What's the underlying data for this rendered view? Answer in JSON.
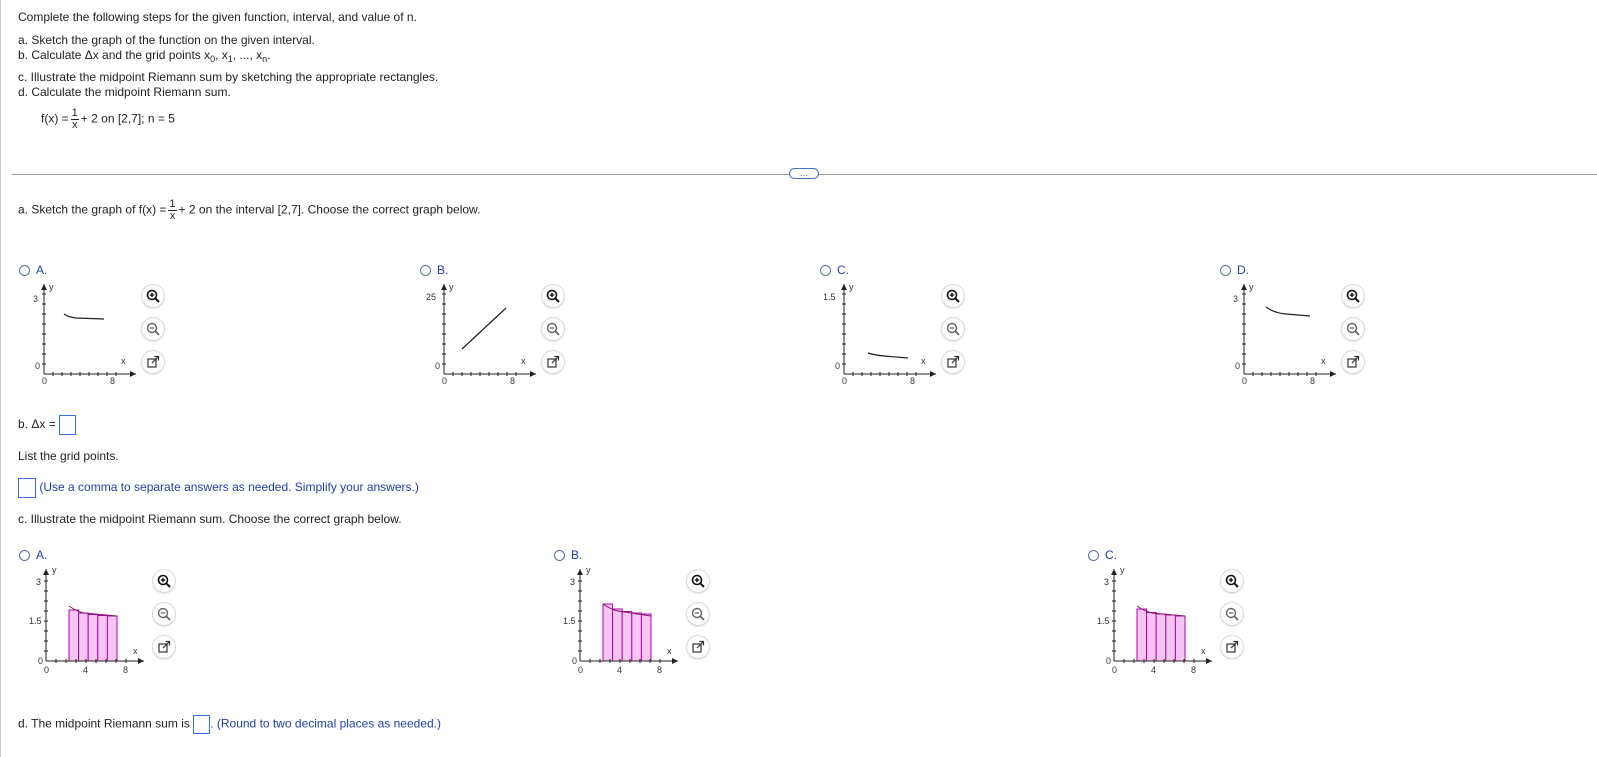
{
  "problem": {
    "instruction": "Complete the following steps for the given function, interval, and value of n.",
    "steps": {
      "a": "a. Sketch the graph of the function on the given interval.",
      "b_pre": "b. Calculate Δx and the grid points x",
      "b_sub0": "0",
      "b_mid1": ", x",
      "b_sub1": "1",
      "b_mid2": ", ..., x",
      "b_subn": "n",
      "b_end": ".",
      "c": "c. Illustrate the midpoint Riemann sum by sketching the appropriate rectangles.",
      "d": "d. Calculate the midpoint Riemann sum."
    },
    "function": {
      "lhs": "f(x) =",
      "num": "1",
      "den": "x",
      "rhs": "+ 2 on [2,7]; n = 5"
    }
  },
  "toggle": {
    "label": "…"
  },
  "part_a": {
    "prompt_pre": "a. Sketch the graph of f(x) =",
    "num": "1",
    "den": "x",
    "prompt_post": "+ 2 on the interval [2,7]. Choose the correct graph below.",
    "options": [
      {
        "label": "A.",
        "y_top": "3",
        "y_zero": "0",
        "x_zero": "0",
        "x_end": "8",
        "x_name": "x",
        "y_name": "y"
      },
      {
        "label": "B.",
        "y_top": "25",
        "y_zero": "0",
        "x_zero": "0",
        "x_end": "8",
        "x_name": "x",
        "y_name": "y"
      },
      {
        "label": "C.",
        "y_top": "1.5",
        "y_zero": "0",
        "x_zero": "0",
        "x_end": "8",
        "x_name": "x",
        "y_name": "y"
      },
      {
        "label": "D.",
        "y_top": "3",
        "y_zero": "0",
        "x_zero": "0",
        "x_end": "8",
        "x_name": "x",
        "y_name": "y"
      }
    ]
  },
  "part_b": {
    "dx_label": "b. Δx =",
    "list_label": "List the grid points.",
    "hint": "(Use a comma to separate answers as needed. Simplify your answers.)"
  },
  "part_c": {
    "prompt": "c. Illustrate the midpoint Riemann sum. Choose the correct graph below.",
    "options": [
      {
        "label": "A.",
        "y_top": "3",
        "y_mid": "1.5",
        "y_zero": "0",
        "x_zero": "0",
        "x_mid": "4",
        "x_end": "8",
        "x_name": "x",
        "y_name": "y"
      },
      {
        "label": "B.",
        "y_top": "3",
        "y_mid": "1.5",
        "y_zero": "0",
        "x_zero": "0",
        "x_mid": "4",
        "x_end": "8",
        "x_name": "x",
        "y_name": "y"
      },
      {
        "label": "C.",
        "y_top": "3",
        "y_mid": "1.5",
        "y_zero": "0",
        "x_zero": "0",
        "x_mid": "4",
        "x_end": "8",
        "x_name": "x",
        "y_name": "y"
      }
    ]
  },
  "part_d": {
    "prompt": "d. The midpoint Riemann sum is",
    "hint": ". (Round to two decimal places as needed.)"
  },
  "icons": [
    "zoom-in-icon",
    "zoom-out-icon",
    "open-new-window-icon"
  ],
  "colors": {
    "link_blue": "#1f3fa8",
    "rect_fill": "#f7c6f0",
    "rect_stroke": "#b300b3",
    "curve": "#222222"
  }
}
